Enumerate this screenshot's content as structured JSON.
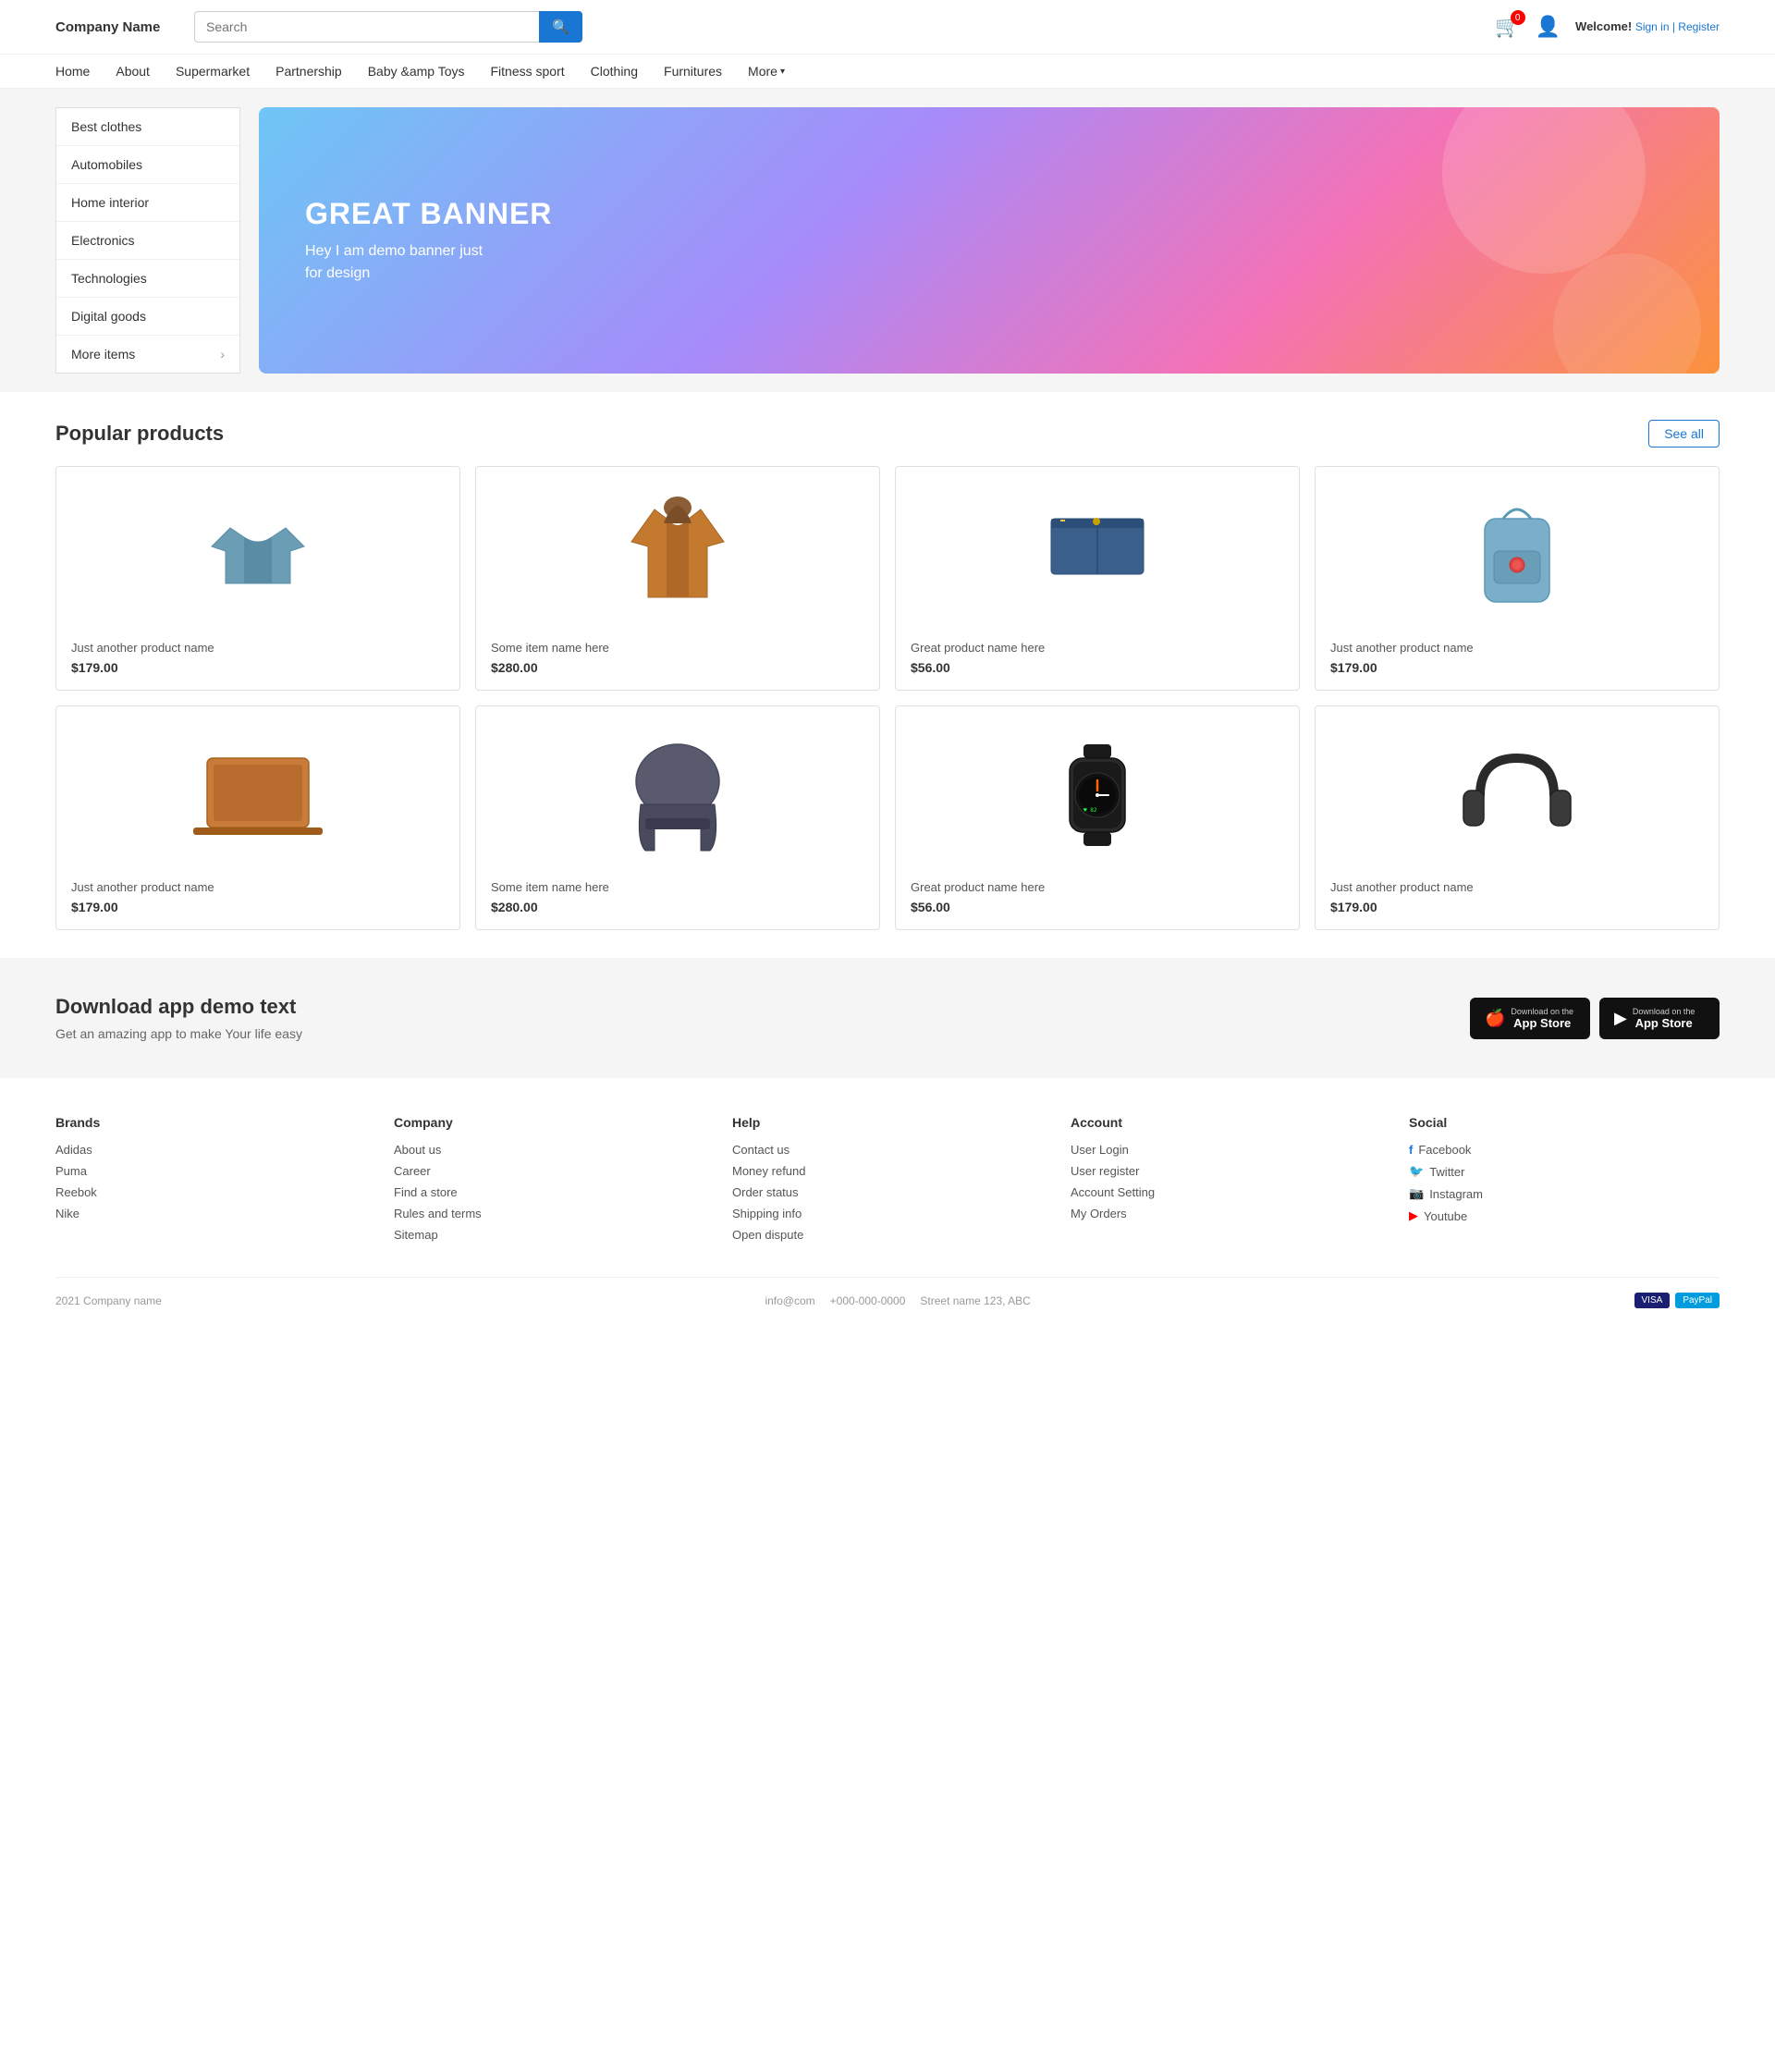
{
  "header": {
    "logo": "Company Name",
    "search_placeholder": "Search",
    "search_button_icon": "🔍",
    "cart_badge": "0",
    "welcome_label": "Welcome!",
    "signin_label": "Sign in | Register"
  },
  "nav": {
    "items": [
      {
        "label": "Home",
        "id": "home"
      },
      {
        "label": "About",
        "id": "about"
      },
      {
        "label": "Supermarket",
        "id": "supermarket"
      },
      {
        "label": "Partnership",
        "id": "partnership"
      },
      {
        "label": "Baby &amp; Toys",
        "id": "baby-toys"
      },
      {
        "label": "Fitness sport",
        "id": "fitness"
      },
      {
        "label": "Clothing",
        "id": "clothing"
      },
      {
        "label": "Furnitures",
        "id": "furnitures"
      },
      {
        "label": "More",
        "id": "more"
      }
    ]
  },
  "sidebar": {
    "items": [
      {
        "label": "Best clothes",
        "arrow": false
      },
      {
        "label": "Automobiles",
        "arrow": false
      },
      {
        "label": "Home interior",
        "arrow": false
      },
      {
        "label": "Electronics",
        "arrow": false
      },
      {
        "label": "Technologies",
        "arrow": false
      },
      {
        "label": "Digital goods",
        "arrow": false
      },
      {
        "label": "More items",
        "arrow": true
      }
    ]
  },
  "banner": {
    "title": "GREAT BANNER",
    "subtitle": "Hey I am demo banner just\nfor design"
  },
  "popular_products": {
    "section_title": "Popular products",
    "see_all_label": "See all",
    "products": [
      {
        "name": "Just another product name",
        "price": "$179.00",
        "type": "shirt"
      },
      {
        "name": "Some item name here",
        "price": "$280.00",
        "type": "jacket"
      },
      {
        "name": "Great product name here",
        "price": "$56.00",
        "type": "shorts"
      },
      {
        "name": "Just another product name",
        "price": "$179.00",
        "type": "backpack"
      },
      {
        "name": "Just another product name",
        "price": "$179.00",
        "type": "laptop"
      },
      {
        "name": "Some item name here",
        "price": "$280.00",
        "type": "chair"
      },
      {
        "name": "Great product name here",
        "price": "$56.00",
        "type": "watch"
      },
      {
        "name": "Just another product name",
        "price": "$179.00",
        "type": "headphones"
      }
    ]
  },
  "app_section": {
    "title": "Download app demo text",
    "subtitle": "Get an amazing app to make Your life easy",
    "btn1_top": "Download on the",
    "btn1_main": "App Store",
    "btn2_top": "Download on the",
    "btn2_main": "App Store"
  },
  "footer": {
    "brands": {
      "title": "Brands",
      "items": [
        "Adidas",
        "Puma",
        "Reebok",
        "Nike"
      ]
    },
    "company": {
      "title": "Company",
      "items": [
        "About us",
        "Career",
        "Find a store",
        "Rules and terms",
        "Sitemap"
      ]
    },
    "help": {
      "title": "Help",
      "items": [
        "Contact us",
        "Money refund",
        "Order status",
        "Shipping info",
        "Open dispute"
      ]
    },
    "account": {
      "title": "Account",
      "items": [
        "User Login",
        "User register",
        "Account Setting",
        "My Orders"
      ]
    },
    "social": {
      "title": "Social",
      "items": [
        {
          "label": "Facebook",
          "icon": "f"
        },
        {
          "label": "Twitter",
          "icon": "t"
        },
        {
          "label": "Instagram",
          "icon": "i"
        },
        {
          "label": "Youtube",
          "icon": "y"
        }
      ]
    },
    "bottom": {
      "copyright": "2021 Company name",
      "email": "info@com",
      "phone": "+000-000-0000",
      "address": "Street name 123, ABC"
    }
  }
}
